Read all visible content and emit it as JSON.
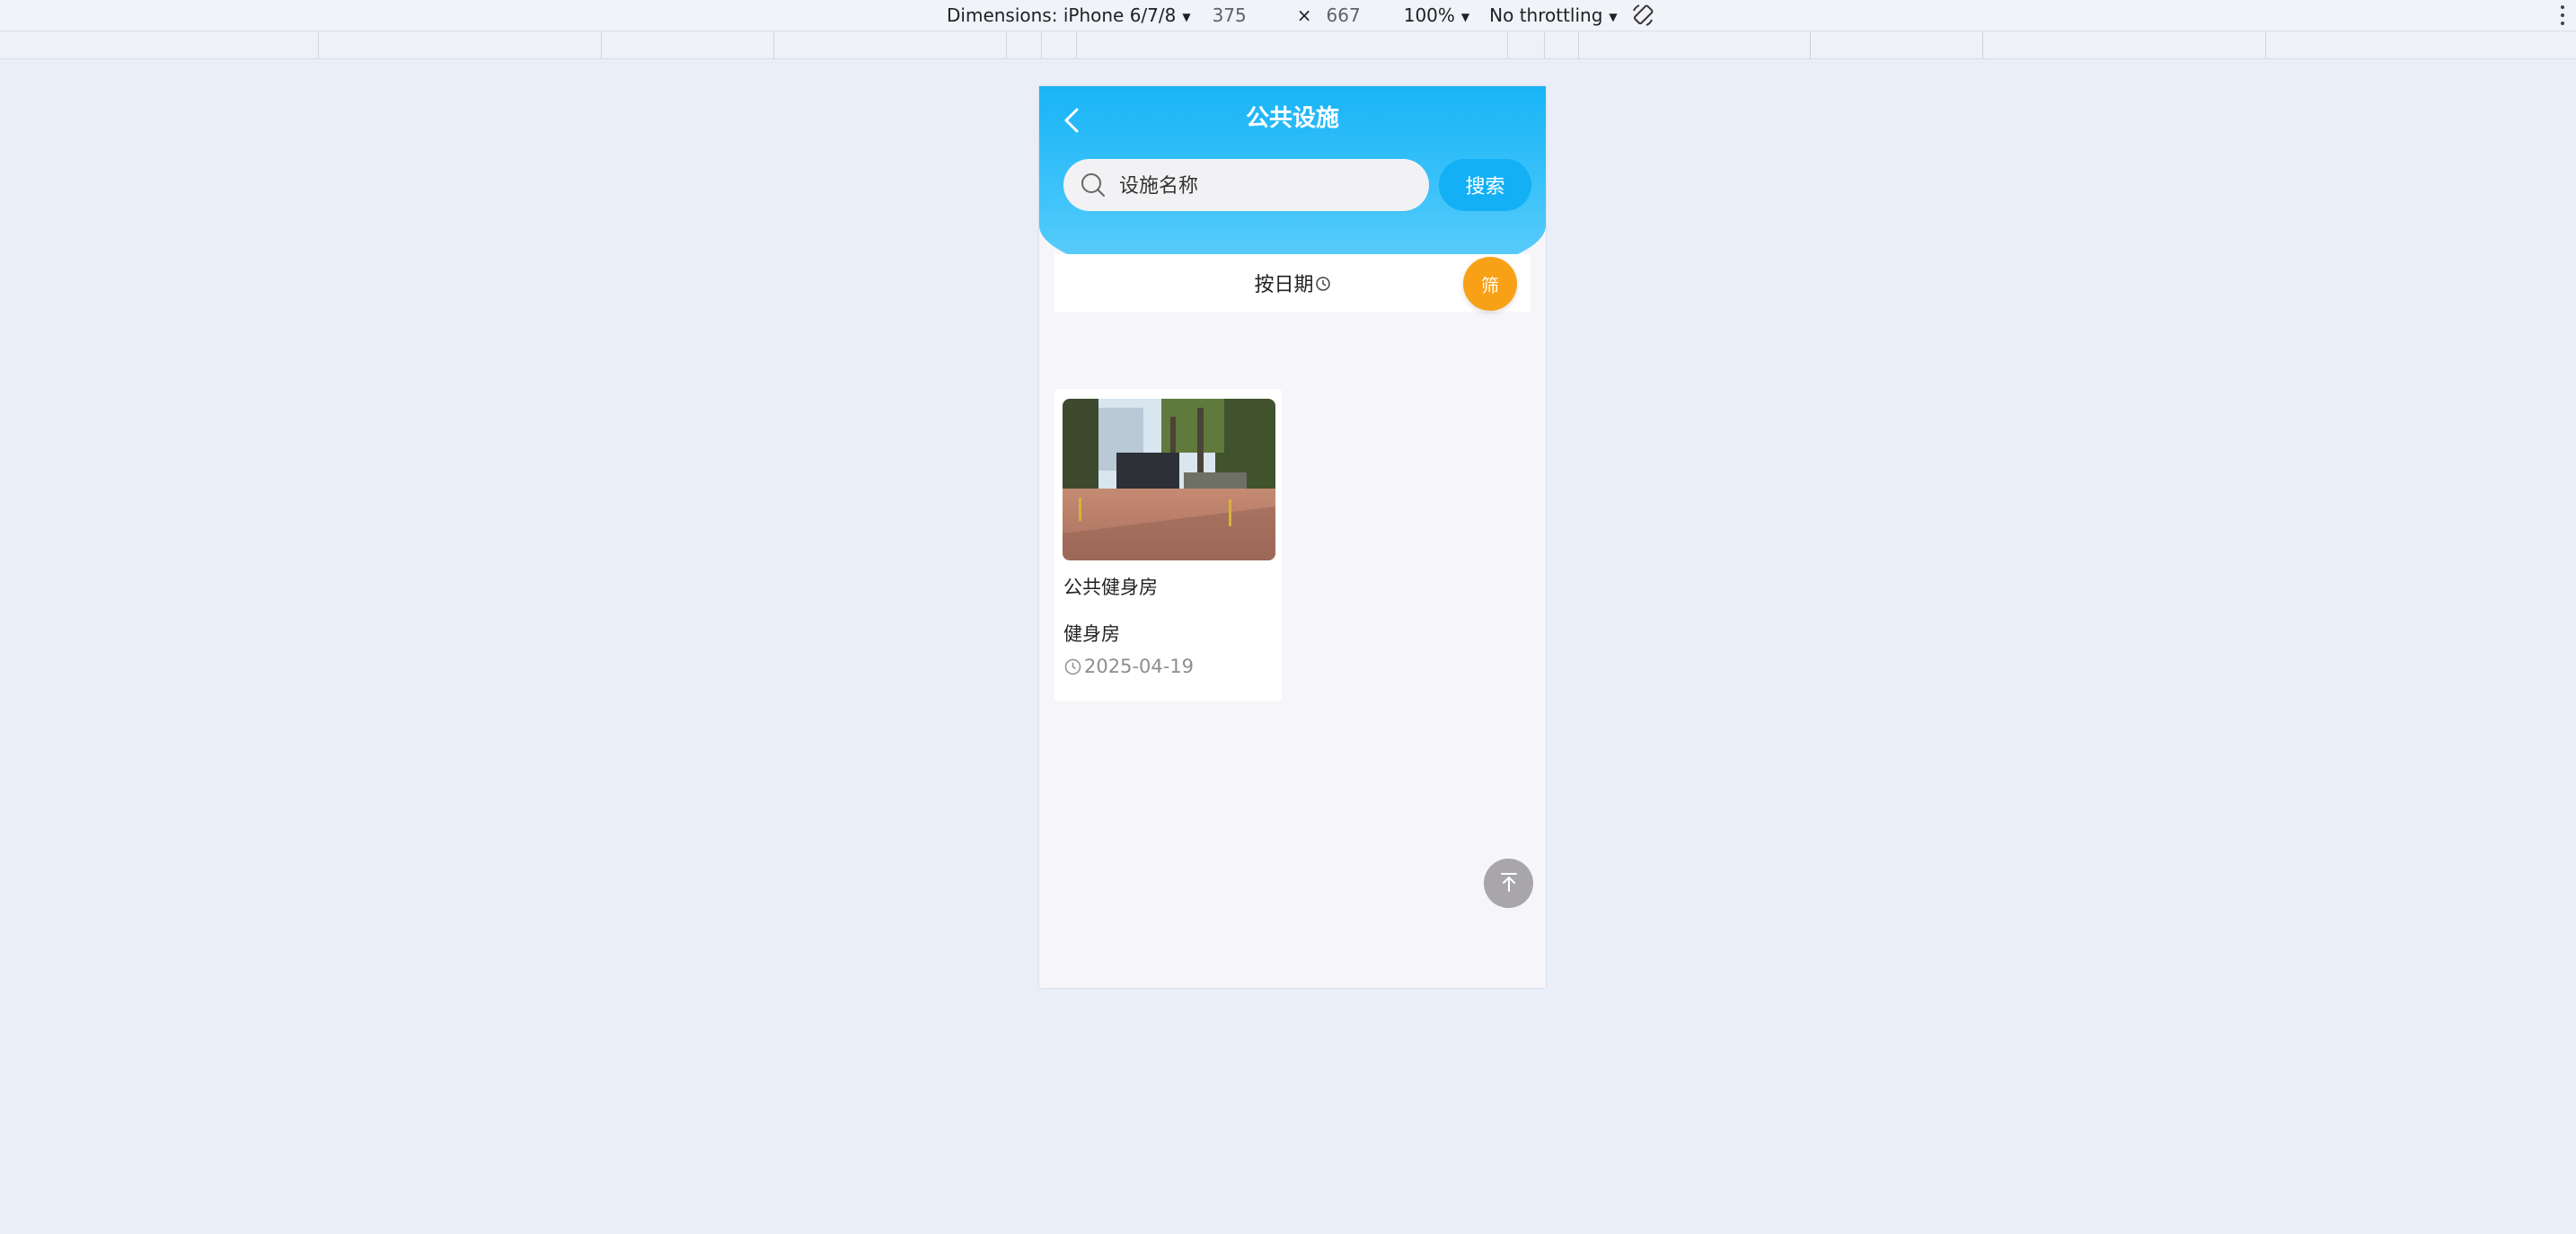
{
  "devtools": {
    "dimensions_label": "Dimensions: iPhone 6/7/8",
    "width": "375",
    "times": "×",
    "height": "667",
    "zoom": "100%",
    "throttling": "No throttling",
    "icons": [
      "caret-down-icon",
      "rotate-icon",
      "more-vert-icon"
    ]
  },
  "app": {
    "title": "公共设施",
    "search": {
      "placeholder": "设施名称",
      "value": "",
      "button_label": "搜索"
    },
    "sort": {
      "label": "按日期"
    },
    "filter_label": "筛",
    "items": [
      {
        "title": "公共健身房",
        "category": "健身房",
        "date": "2025-04-19"
      }
    ],
    "colors": {
      "header": "#19b4f6",
      "filter": "#f9a116",
      "search_button": "#13b0f5",
      "back_to_top": "#a9a6ab"
    },
    "icons": [
      "back-arrow-icon",
      "search-icon",
      "clock-icon",
      "arrow-up-to-top-icon"
    ]
  }
}
